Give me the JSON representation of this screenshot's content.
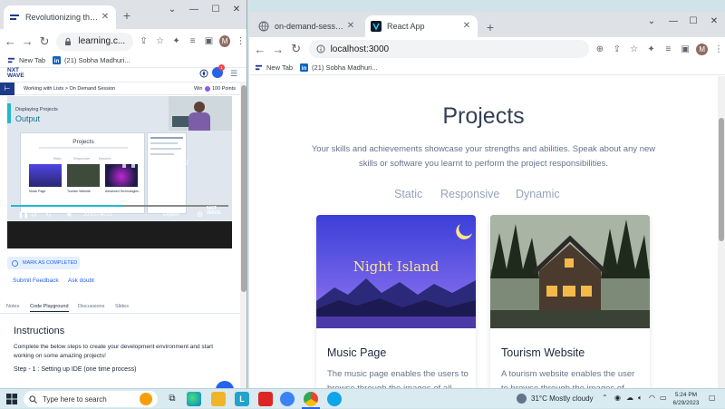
{
  "left_window": {
    "tabs": [
      {
        "title": "Revolutionizing the Job Ma",
        "active": true
      }
    ],
    "address": "learning.c...",
    "bookmarks": [
      {
        "label": "New Tab"
      },
      {
        "label": "(21) Sobha Madhuri..."
      }
    ],
    "avatar_letter": "M",
    "brand": {
      "line1": "NXT",
      "line2": "WAVE"
    },
    "notif_count": "1",
    "lesson": {
      "breadcrumb": "Working with Lists > On Demand Session",
      "win_prefix": "Win",
      "points": "100 Points"
    },
    "video": {
      "heading_small": "Displaying Projects",
      "heading_big": "Output",
      "slide_title": "Projects",
      "slide_filters": [
        "Static",
        "Responsive",
        "Dynamic"
      ],
      "slide_cards": [
        "Music Page",
        "Tourism Website",
        "Advanced Technologies"
      ],
      "time": "20:53 / 40:21",
      "language": "English"
    },
    "mark_completed": "MARK AS COMPLETED",
    "submit_feedback": "Submit Feedback",
    "ask_doubt": "Ask doubt",
    "sub_tabs": [
      "Notes",
      "Code Playground",
      "Discussions",
      "Slides"
    ],
    "active_sub_tab": "Code Playground",
    "instructions_title": "Instructions",
    "instructions_text": "Complete the below steps to create your development environment and start working on some amazing projects!",
    "step1": "Step - 1 : Setting up IDE (one time process)"
  },
  "right_window": {
    "tabs": [
      {
        "title": "on-demand-session — CCBP IDE",
        "active": false
      },
      {
        "title": "React App",
        "active": true
      }
    ],
    "address": "localhost:3000",
    "bookmarks": [
      {
        "label": "New Tab"
      },
      {
        "label": "(21) Sobha Madhuri..."
      }
    ],
    "avatar_letter": "M",
    "page": {
      "title": "Projects",
      "description": "Your skills and achievements showcase your strengths and abilities. Speak about any new skills or software you learnt to perform the project responsibilities.",
      "filters": [
        "Static",
        "Responsive",
        "Dynamic"
      ],
      "cards": [
        {
          "image_text": "Night Island",
          "title": "Music Page",
          "description": "The music page enables the users to browse through the images of all-"
        },
        {
          "title": "Tourism Website",
          "description": "A tourism website enables the user to browse through the images of"
        }
      ]
    }
  },
  "taskbar": {
    "search_placeholder": "Type here to search",
    "weather": "31°C  Mostly cloudy",
    "time": "5:24 PM",
    "date": "6/29/2023"
  }
}
